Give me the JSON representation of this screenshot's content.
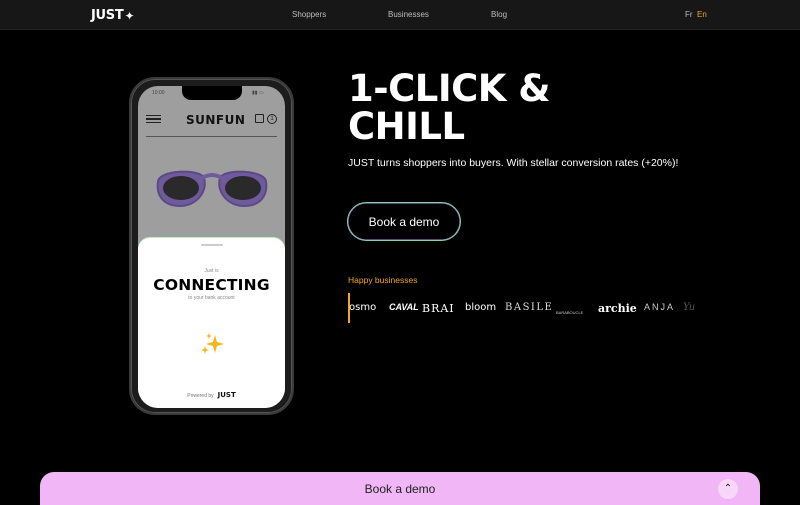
{
  "header": {
    "logo": "JUST",
    "nav": [
      "Shoppers",
      "Businesses",
      "Blog"
    ],
    "lang_fr": "Fr",
    "lang_en": "En",
    "active_lang_color": "#f5a623"
  },
  "phone": {
    "time": "10:00",
    "shop_name": "SUNFUN",
    "cart_count": "1",
    "just_is": "Just is",
    "connecting": "CONNECTING",
    "bank_text": "to your bank account",
    "powered_by": "Powered by",
    "powered_brand": "JUST"
  },
  "hero": {
    "title_line1": "1-CLICK &",
    "title_line2": "CHILL",
    "subtitle": "JUST turns shoppers into buyers. With stellar conversion rates (+20%)!",
    "demo_button": "Book a demo"
  },
  "businesses": {
    "label": "Happy businesses",
    "brands": [
      "osmo",
      "CAVAL",
      "BRAI",
      "bloom",
      "BASILE",
      "BARABOUCLE",
      "archie",
      "ANJA",
      "Yu"
    ]
  },
  "bottom_bar": {
    "label": "Book a demo",
    "icon": "chevron-up-icon",
    "color": "#f0b6f5"
  }
}
